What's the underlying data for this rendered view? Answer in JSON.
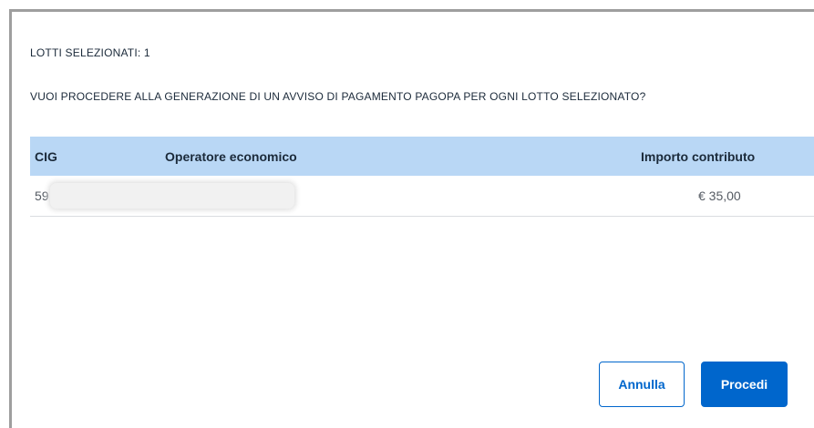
{
  "dialog": {
    "lots_selected": "LOTTI SELEZIONATI: 1",
    "question": "VUOI PROCEDERE ALLA GENERAZIONE DI UN AVVISO DI PAGAMENTO PAGOPA PER OGNI LOTTO SELEZIONATO?"
  },
  "table": {
    "headers": {
      "cig": "CIG",
      "operator": "Operatore economico",
      "amount": "Importo contributo"
    },
    "rows": [
      {
        "cig": "59",
        "operator": "",
        "amount": "€ 35,00"
      }
    ]
  },
  "buttons": {
    "cancel": "Annulla",
    "proceed": "Procedi"
  },
  "colors": {
    "header_bg": "#b9d7f5",
    "primary": "#0066cc"
  }
}
